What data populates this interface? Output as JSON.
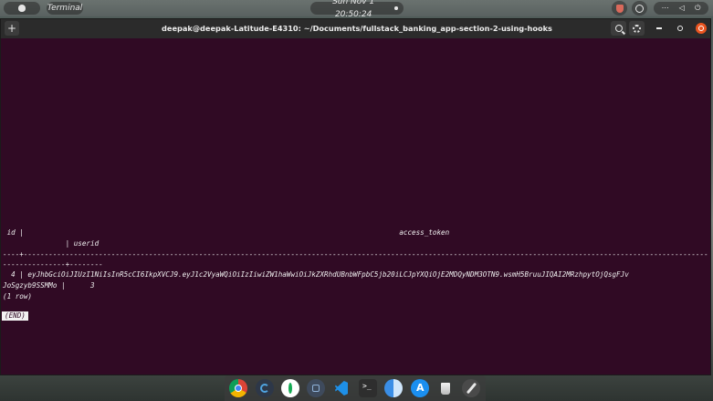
{
  "top_panel": {
    "app_name": "Terminal",
    "clock": "Sun Nov 1  20:50:24"
  },
  "window": {
    "title": "deepak@deepak-Latitude-E4310: ~/Documents/fullstack_banking_app-section-2-using-hooks",
    "new_tab_glyph": "+"
  },
  "terminal": {
    "lines": {
      "header1": " id |                                                                                          access_token",
      "header2": "               | userid",
      "separator": "----+-------------------------------------------------------------------------------------------------------------------------------------------------------------------------------------",
      "separator2": "---------------+--------",
      "data1": "  4 | eyJhbGciOiJIUzI1NiIsInR5cCI6IkpXVCJ9.eyJ1c2VyaWQiOiIzIiwiZW1haWwiOiJkZXRhdUBnbWFpbC5jb20iLCJpYXQiOjE2MDQyNDM3OTN9.wsmH5BruuJIQAI2MRzhpytOjQsgFJv",
      "data2": "JoSgzyb9SSMMo |      3",
      "row_count": "(1 row)"
    },
    "end_marker": "(END)"
  },
  "icons": {
    "apple": "apple-logo-icon",
    "clock_dot": "notification-dot-icon",
    "tray": [
      "shield-icon",
      "accessibility-icon",
      "network-icon",
      "volume-icon",
      "power-icon"
    ],
    "titlebar": [
      "new-tab-icon",
      "search-icon",
      "gear-icon",
      "minimize-icon",
      "maximize-icon",
      "close-icon"
    ],
    "dock": [
      "chrome-icon",
      "chart-app-icon",
      "mongodb-icon",
      "database-icon",
      "vscode-icon",
      "terminal-icon",
      "finder-icon",
      "app-store-icon",
      "trash-icon",
      "launchpad-icon"
    ]
  },
  "colors": {
    "terminal_background": "#300a24",
    "terminal_text": "#f0f0f0",
    "titlebar": "#2b2b2b",
    "close_button": "#e95420"
  }
}
